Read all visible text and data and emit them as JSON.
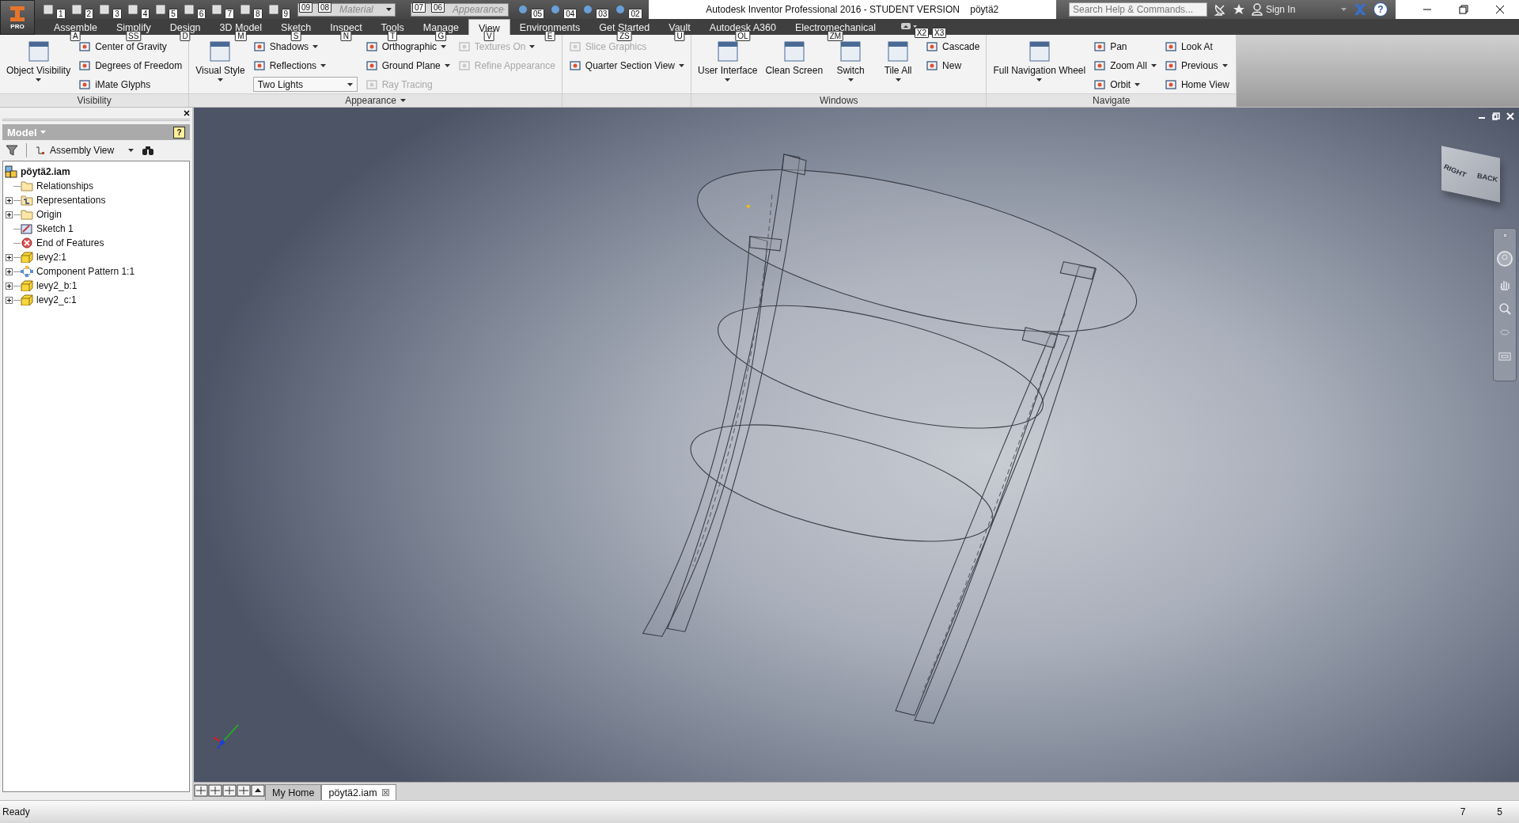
{
  "app_button": {
    "label": "PRO"
  },
  "quick_access": {
    "buttons_a": [
      {
        "keytip": "1"
      },
      {
        "keytip": "2"
      },
      {
        "keytip": "3"
      },
      {
        "keytip": "4"
      },
      {
        "keytip": "5"
      },
      {
        "keytip": "6"
      },
      {
        "keytip": "7"
      },
      {
        "keytip": "8"
      },
      {
        "keytip": "9"
      }
    ],
    "material": {
      "placeholder": "Material",
      "keytips": [
        "09",
        "08"
      ]
    },
    "appearance": {
      "placeholder": "Appearance",
      "keytips": [
        "07",
        "06"
      ]
    },
    "buttons_b": [
      {
        "keytip": "05"
      },
      {
        "keytip": "04"
      },
      {
        "keytip": "03"
      },
      {
        "keytip": "02"
      }
    ]
  },
  "window": {
    "title": "Autodesk Inventor Professional 2016 - STUDENT VERSION",
    "document": "pöytä2"
  },
  "search": {
    "placeholder": "Search Help & Commands..."
  },
  "sign_in": "Sign In",
  "help_button": "?",
  "tabs": [
    {
      "label": "Assemble",
      "keytip": "A",
      "selected": false
    },
    {
      "label": "Simplify",
      "keytip": "SS",
      "selected": false
    },
    {
      "label": "Design",
      "keytip": "D",
      "selected": false
    },
    {
      "label": "3D Model",
      "keytip": "M",
      "selected": false
    },
    {
      "label": "Sketch",
      "keytip": "S",
      "selected": false
    },
    {
      "label": "Inspect",
      "keytip": "N",
      "selected": false
    },
    {
      "label": "Tools",
      "keytip": "T",
      "selected": false
    },
    {
      "label": "Manage",
      "keytip": "G",
      "selected": false
    },
    {
      "label": "View",
      "keytip": "V",
      "selected": true
    },
    {
      "label": "Environments",
      "keytip": "E",
      "selected": false
    },
    {
      "label": "Get Started",
      "keytip": "ZS",
      "selected": false
    },
    {
      "label": "Vault",
      "keytip": "U",
      "selected": false
    },
    {
      "label": "Autodesk A360",
      "keytip": "OL",
      "selected": false
    },
    {
      "label": "Electromechanical",
      "keytip": "ZM",
      "selected": false
    }
  ],
  "panels": [
    {
      "title": "Visibility",
      "title_menu": false,
      "groups": [
        {
          "kind": "large",
          "label": "Object Visibility",
          "dropdown": true
        },
        {
          "kind": "column",
          "items": [
            {
              "kind": "button",
              "label": "Center of Gravity",
              "dropdown": false,
              "disabled": false
            },
            {
              "kind": "button",
              "label": "Degrees of Freedom",
              "dropdown": false,
              "disabled": false
            },
            {
              "kind": "button",
              "label": "iMate Glyphs",
              "dropdown": false,
              "disabled": false
            }
          ]
        }
      ]
    },
    {
      "title": "Appearance",
      "title_menu": true,
      "groups": [
        {
          "kind": "large",
          "label": "Visual Style",
          "dropdown": true
        },
        {
          "kind": "column",
          "items": [
            {
              "kind": "button",
              "label": "Shadows",
              "dropdown": true,
              "disabled": false
            },
            {
              "kind": "button",
              "label": "Reflections",
              "dropdown": true,
              "disabled": false
            },
            {
              "kind": "select",
              "label": "Two Lights"
            }
          ]
        },
        {
          "kind": "column",
          "items": [
            {
              "kind": "button",
              "label": "Orthographic",
              "dropdown": true,
              "disabled": false
            },
            {
              "kind": "button",
              "label": "Ground Plane",
              "dropdown": true,
              "disabled": false
            },
            {
              "kind": "button",
              "label": "Ray Tracing",
              "dropdown": false,
              "disabled": true
            }
          ]
        },
        {
          "kind": "column",
          "items": [
            {
              "kind": "button",
              "label": "Textures On",
              "dropdown": true,
              "disabled": true
            },
            {
              "kind": "button",
              "label": "Refine Appearance",
              "dropdown": false,
              "disabled": true
            }
          ]
        }
      ]
    },
    {
      "groups": [
        {
          "kind": "column",
          "items": [
            {
              "kind": "button",
              "label": "Slice Graphics",
              "dropdown": false,
              "disabled": true
            },
            {
              "kind": "button",
              "label": "Quarter Section View",
              "dropdown": true,
              "disabled": false
            }
          ]
        }
      ]
    },
    {
      "title": "Windows",
      "title_menu": false,
      "groups": [
        {
          "kind": "large",
          "label": "User Interface",
          "dropdown": true
        },
        {
          "kind": "large",
          "label": "Clean Screen",
          "dropdown": false
        },
        {
          "kind": "large",
          "label": "Switch",
          "dropdown": true
        },
        {
          "kind": "large",
          "label": "Tile All",
          "dropdown": true,
          "keytip": "X2"
        },
        {
          "kind": "column",
          "items": [
            {
              "kind": "button",
              "label": "Cascade",
              "dropdown": false,
              "disabled": false,
              "keytip": "X3"
            },
            {
              "kind": "button",
              "label": "New",
              "dropdown": false,
              "disabled": false
            }
          ]
        }
      ]
    },
    {
      "title": "Navigate",
      "title_menu": false,
      "groups": [
        {
          "kind": "large",
          "label": "Full Navigation Wheel",
          "dropdown": true
        },
        {
          "kind": "column",
          "items": [
            {
              "kind": "button",
              "label": "Pan",
              "dropdown": false,
              "disabled": false
            },
            {
              "kind": "button",
              "label": "Zoom All",
              "dropdown": true,
              "disabled": false
            },
            {
              "kind": "button",
              "label": "Orbit",
              "dropdown": true,
              "disabled": false
            }
          ]
        },
        {
          "kind": "column",
          "items": [
            {
              "kind": "button",
              "label": "Look At",
              "dropdown": false,
              "disabled": false
            },
            {
              "kind": "button",
              "label": "Previous",
              "dropdown": true,
              "disabled": false
            },
            {
              "kind": "button",
              "label": "Home View",
              "dropdown": false,
              "disabled": false
            }
          ]
        }
      ]
    }
  ],
  "browser": {
    "title": "Model",
    "help": "?",
    "view": "Assembly View",
    "root": {
      "label": "pöytä2.iam",
      "children": [
        {
          "label": "Relationships",
          "kind": "folder",
          "expander": false
        },
        {
          "label": "Representations",
          "kind": "representations",
          "expander": true
        },
        {
          "label": "Origin",
          "kind": "folder",
          "expander": true
        },
        {
          "label": "Sketch 1",
          "kind": "sketch",
          "expander": false
        },
        {
          "label": "End of Features",
          "kind": "end",
          "expander": false
        },
        {
          "label": "levy2:1",
          "kind": "part",
          "expander": true
        },
        {
          "label": "Component Pattern 1:1",
          "kind": "pattern",
          "expander": true
        },
        {
          "label": "levy2_b:1",
          "kind": "part",
          "expander": true
        },
        {
          "label": "levy2_c:1",
          "kind": "part",
          "expander": true
        }
      ]
    }
  },
  "viewcube": {
    "faces": [
      "RIGHT",
      "BACK"
    ]
  },
  "document_tabs": [
    {
      "label": "My Home",
      "selected": false
    },
    {
      "label": "pöytä2.iam",
      "selected": true
    }
  ],
  "status_bar": {
    "text": "Ready",
    "values": [
      "7",
      "5"
    ]
  }
}
